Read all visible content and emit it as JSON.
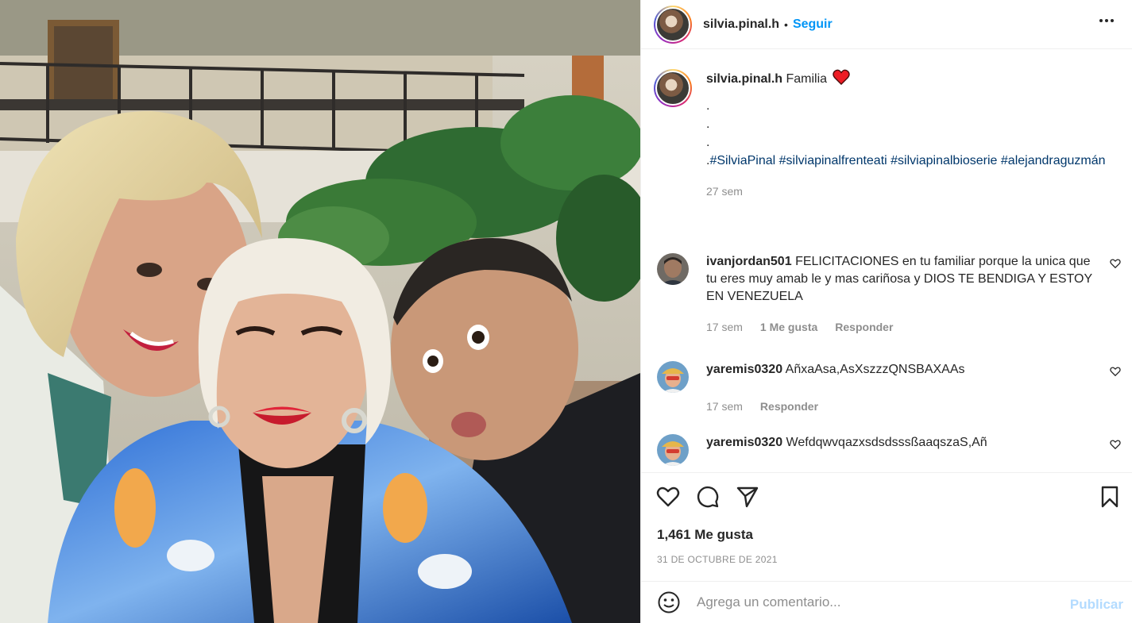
{
  "post": {
    "author": "silvia.pinal.h",
    "separator": "•",
    "follow_label": "Seguir",
    "more_icon": "more-horizontal-icon"
  },
  "caption": {
    "user": "silvia.pinal.h",
    "text": "Familia",
    "emoji": "red-heart",
    "dots": [
      ".",
      ".",
      "."
    ],
    "hashtag_prefix": ".",
    "hashtags": [
      "#SilviaPinal",
      "#silviapinalfrenteati",
      "#silviapinalbioserie",
      "#alejandraguzmán"
    ],
    "time": "27 sem"
  },
  "comments": [
    {
      "user": "ivanjordan501",
      "text": "FELICITACIONES en tu familiar porque la unica que tu eres muy amab le y mas cariñosa y DIOS TE BENDIGA Y ESTOY EN VENEZUELA",
      "time": "17 sem",
      "likes": "1 Me gusta",
      "reply": "Responder"
    },
    {
      "user": "yaremis0320",
      "text": "AñxaAsa,AsXszzzQNSBAXAAs",
      "time": "17 sem",
      "reply": "Responder"
    },
    {
      "user": "yaremis0320",
      "text": "WefdqwvqazxsdsdsssßaaqszaS,Añ"
    }
  ],
  "stats": {
    "likes": "1,461 Me gusta",
    "date": "31 DE OCTUBRE DE 2021"
  },
  "composer": {
    "placeholder": "Agrega un comentario...",
    "publish_label": "Publicar"
  },
  "colors": {
    "accent": "#0095f6",
    "hashtag": "#00376b",
    "muted": "#8e8e8e",
    "publish_disabled": "#b3dbff",
    "heart": "#ed1c24"
  }
}
